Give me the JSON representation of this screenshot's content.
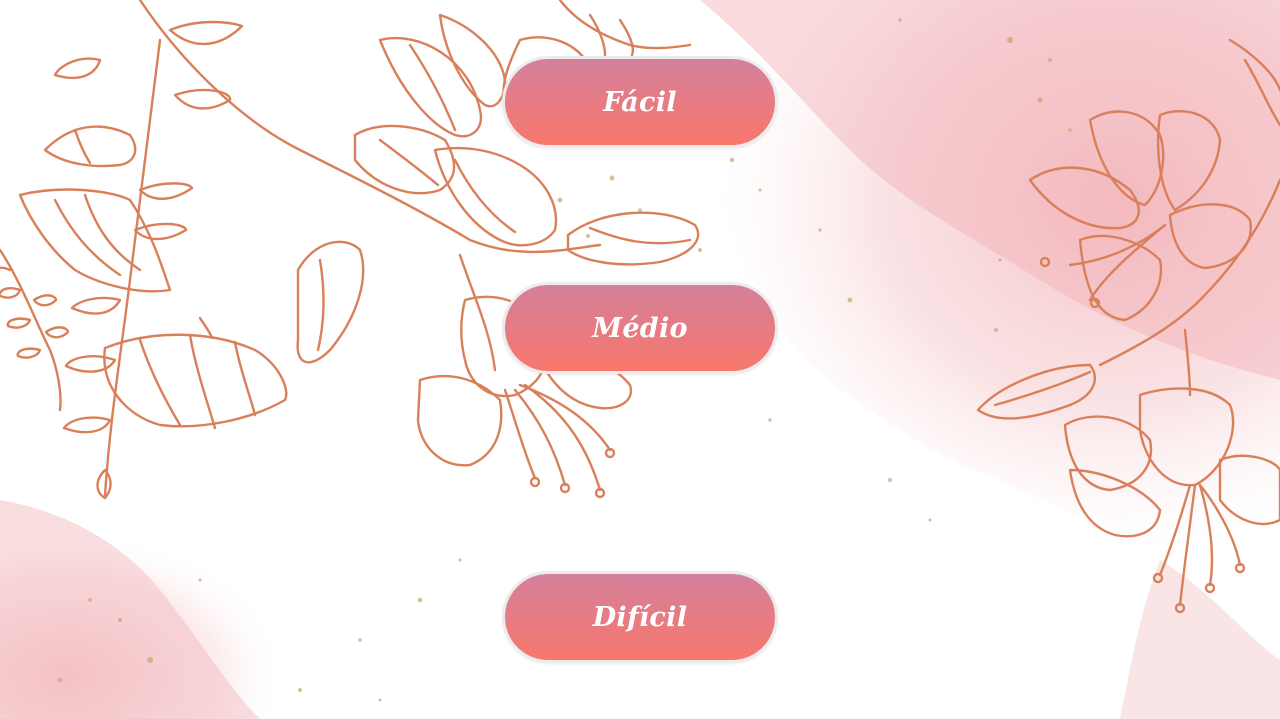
{
  "menu": {
    "buttons": [
      {
        "id": "easy",
        "label": "Fácil"
      },
      {
        "id": "medium",
        "label": "Médio"
      },
      {
        "id": "hard",
        "label": "Difícil"
      }
    ]
  },
  "theme": {
    "button_gradient_top": "#d4809c",
    "button_gradient_bottom": "#f8776c",
    "button_border": "#ececec",
    "label_color": "#ffffff",
    "line_art_color": "#d9805a",
    "watercolor_pink": "#f4c2c6",
    "gold_speckle": "#c9a46a"
  },
  "background": {
    "description_icons": [
      "lily-flower-illustration",
      "pink-watercolor-wash",
      "gold-speckles"
    ]
  }
}
